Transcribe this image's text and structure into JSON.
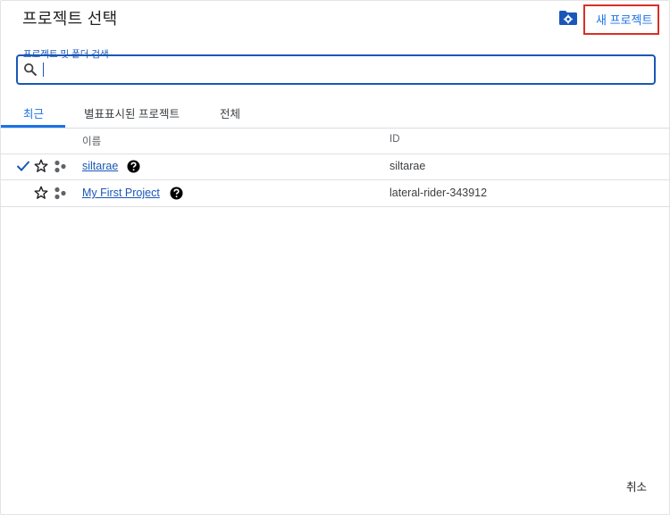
{
  "dialog": {
    "title": "프로젝트 선택",
    "new_project_label": "새 프로젝트",
    "cancel_label": "취소"
  },
  "search": {
    "label": "프로젝트 및 폴더 검색",
    "value": ""
  },
  "tabs": [
    {
      "label": "최근",
      "active": true
    },
    {
      "label": "별표표시된 프로젝트",
      "active": false
    },
    {
      "label": "전체",
      "active": false
    }
  ],
  "table": {
    "columns": [
      "이름",
      "ID"
    ],
    "rows": [
      {
        "name": "siltarae",
        "id": "siltarae",
        "selected": true,
        "starred": false
      },
      {
        "name": "My First Project",
        "id": "lateral-rider-343912",
        "selected": false,
        "starred": false
      }
    ]
  },
  "colors": {
    "accent": "#1a73e8",
    "link": "#1a57b8",
    "highlight_border": "#d93025"
  },
  "icons": [
    "folder-settings-icon",
    "search-icon",
    "check-icon",
    "star-outline-icon",
    "resource-hierarchy-icon",
    "help-icon"
  ]
}
